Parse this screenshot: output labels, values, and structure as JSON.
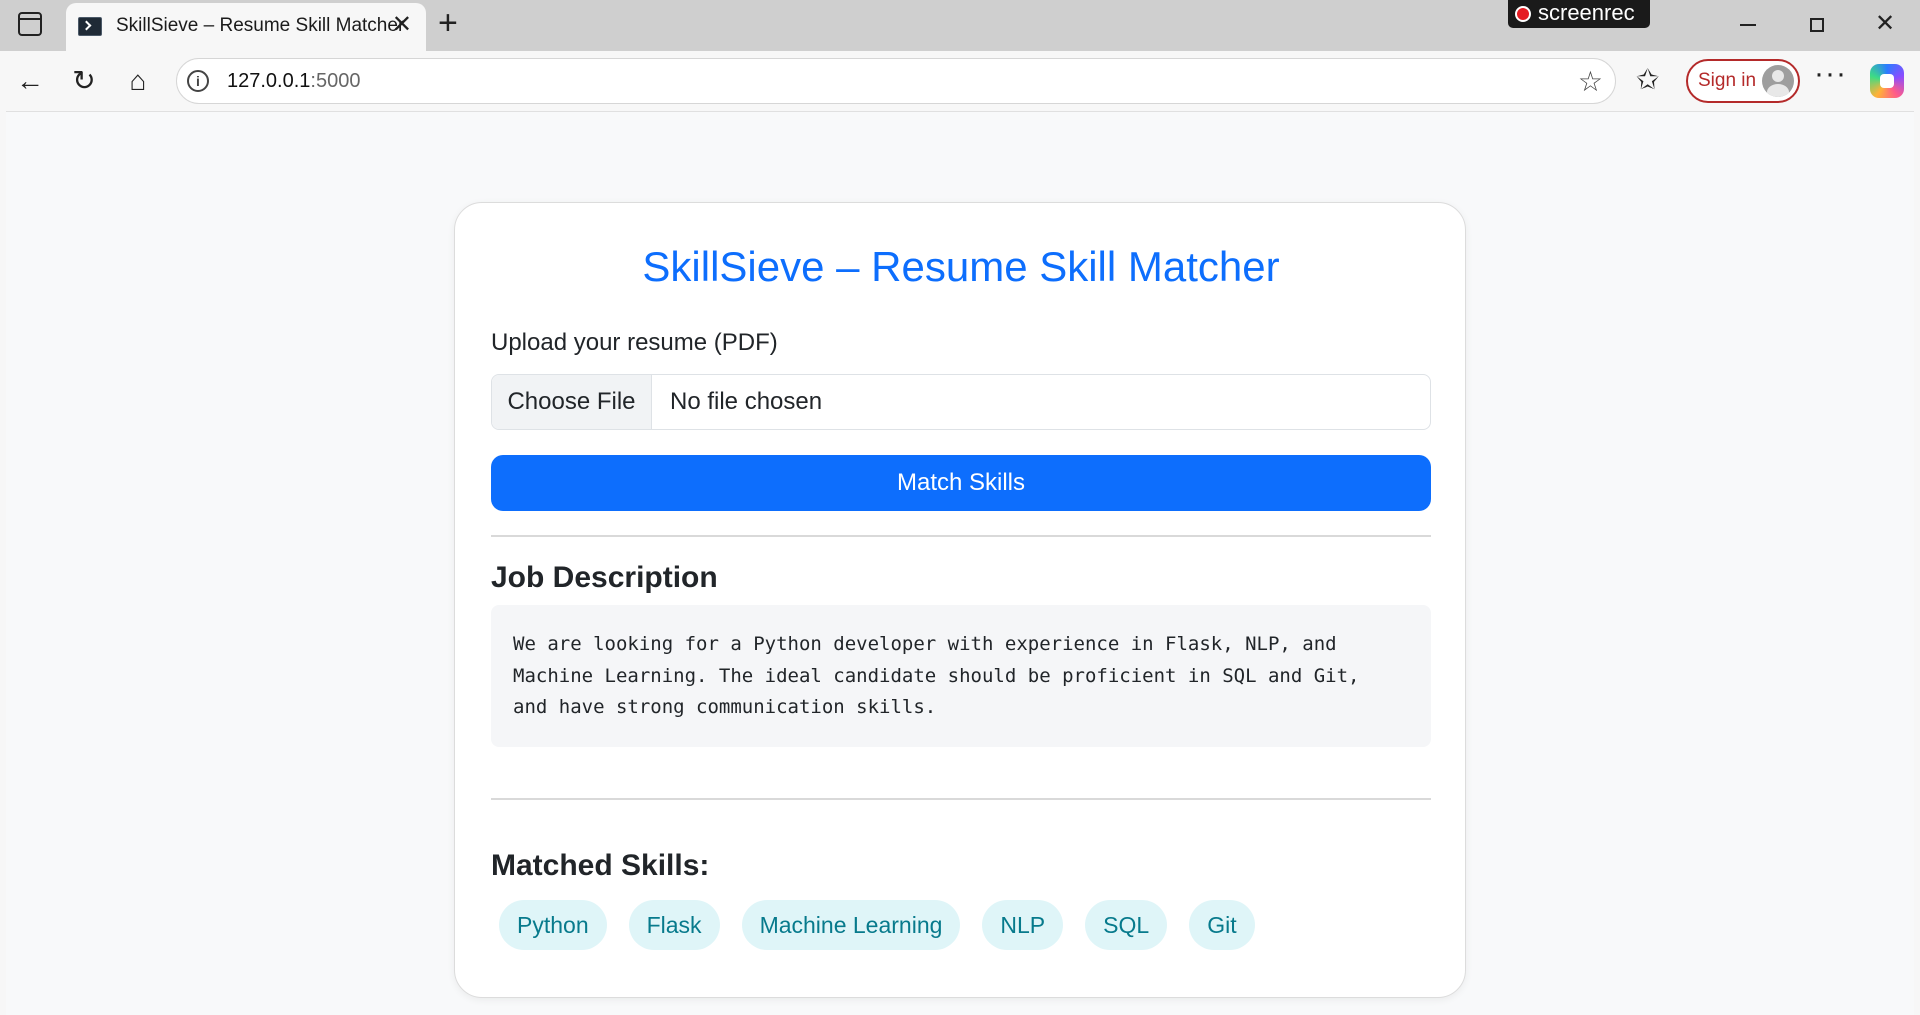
{
  "browser": {
    "tab_title": "SkillSieve – Resume Skill Matcher",
    "tab_close": "✕",
    "new_tab": "+",
    "url_host": "127.0.0.1",
    "url_port": ":5000",
    "sign_in_label": "Sign in",
    "recording_badge": "screenrec",
    "icons": [
      "sidebar-toggle-icon",
      "terminal-favicon-icon",
      "close-icon",
      "plus-icon",
      "back-arrow-icon",
      "reload-icon",
      "home-icon",
      "info-icon",
      "star-icon",
      "favorites-icon",
      "avatar-icon",
      "more-icon",
      "copilot-icon",
      "minimize-icon",
      "restore-icon",
      "close-window-icon"
    ]
  },
  "page": {
    "title": "SkillSieve – Resume Skill Matcher",
    "upload_label": "Upload your resume (PDF)",
    "choose_file_label": "Choose File",
    "file_status": "No file chosen",
    "match_button": "Match Skills",
    "job_description_heading": "Job Description",
    "job_description_text": "We are looking for a Python developer with experience in Flask, NLP, and\nMachine Learning. The ideal candidate should be proficient in SQL and Git,\nand have strong communication skills.",
    "matched_heading": "Matched Skills:",
    "skills": [
      "Python",
      "Flask",
      "Machine Learning",
      "NLP",
      "SQL",
      "Git"
    ]
  },
  "colors": {
    "accent": "#0d6efd",
    "skill_badge_bg": "#dff5f8",
    "skill_badge_text": "#077a8c",
    "signin_border": "#b42a2a"
  }
}
